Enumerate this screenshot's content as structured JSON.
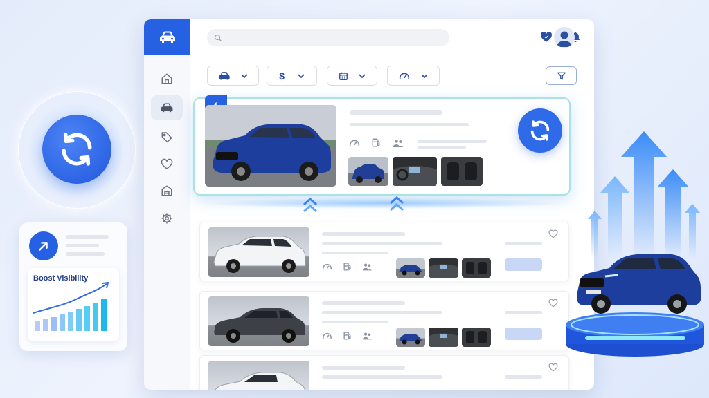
{
  "search": {
    "placeholder": ""
  },
  "boost": {
    "title": "Boost Visibility"
  },
  "sidebar": {
    "items": [
      {
        "icon": "home-icon"
      },
      {
        "icon": "car-icon",
        "active": true
      },
      {
        "icon": "tag-icon"
      },
      {
        "icon": "heart-icon"
      },
      {
        "icon": "dealership-icon"
      },
      {
        "icon": "settings-gear-icon"
      }
    ]
  },
  "header": {
    "icons": [
      "favorites-heart-icon",
      "bell-icon",
      "user-avatar-icon"
    ]
  },
  "filters": [
    {
      "icon": "car-icon",
      "value": ""
    },
    {
      "icon": "dollar-icon",
      "value": "$"
    },
    {
      "icon": "calendar-icon",
      "value": ""
    },
    {
      "icon": "speedometer-icon",
      "value": ""
    }
  ],
  "featured_listing": {
    "car_color": "blue",
    "badge_icon": "lightning-icon",
    "action_icon": "refresh-icon"
  },
  "listings": [
    {
      "car_color": "white"
    },
    {
      "car_color": "dark-gray"
    },
    {
      "car_color": "white"
    }
  ],
  "colors": {
    "accent": "#2761e3",
    "highlight_border": "#a8e4e6",
    "background": "#e8effc"
  }
}
